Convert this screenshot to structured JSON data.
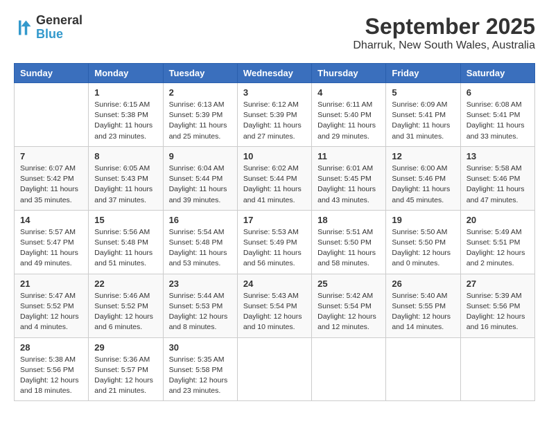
{
  "header": {
    "logo_line1": "General",
    "logo_line2": "Blue",
    "title": "September 2025",
    "subtitle": "Dharruk, New South Wales, Australia"
  },
  "calendar": {
    "days_of_week": [
      "Sunday",
      "Monday",
      "Tuesday",
      "Wednesday",
      "Thursday",
      "Friday",
      "Saturday"
    ],
    "weeks": [
      [
        {
          "day": "",
          "sunrise": "",
          "sunset": "",
          "daylight": ""
        },
        {
          "day": "1",
          "sunrise": "Sunrise: 6:15 AM",
          "sunset": "Sunset: 5:38 PM",
          "daylight": "Daylight: 11 hours and 23 minutes."
        },
        {
          "day": "2",
          "sunrise": "Sunrise: 6:13 AM",
          "sunset": "Sunset: 5:39 PM",
          "daylight": "Daylight: 11 hours and 25 minutes."
        },
        {
          "day": "3",
          "sunrise": "Sunrise: 6:12 AM",
          "sunset": "Sunset: 5:39 PM",
          "daylight": "Daylight: 11 hours and 27 minutes."
        },
        {
          "day": "4",
          "sunrise": "Sunrise: 6:11 AM",
          "sunset": "Sunset: 5:40 PM",
          "daylight": "Daylight: 11 hours and 29 minutes."
        },
        {
          "day": "5",
          "sunrise": "Sunrise: 6:09 AM",
          "sunset": "Sunset: 5:41 PM",
          "daylight": "Daylight: 11 hours and 31 minutes."
        },
        {
          "day": "6",
          "sunrise": "Sunrise: 6:08 AM",
          "sunset": "Sunset: 5:41 PM",
          "daylight": "Daylight: 11 hours and 33 minutes."
        }
      ],
      [
        {
          "day": "7",
          "sunrise": "Sunrise: 6:07 AM",
          "sunset": "Sunset: 5:42 PM",
          "daylight": "Daylight: 11 hours and 35 minutes."
        },
        {
          "day": "8",
          "sunrise": "Sunrise: 6:05 AM",
          "sunset": "Sunset: 5:43 PM",
          "daylight": "Daylight: 11 hours and 37 minutes."
        },
        {
          "day": "9",
          "sunrise": "Sunrise: 6:04 AM",
          "sunset": "Sunset: 5:44 PM",
          "daylight": "Daylight: 11 hours and 39 minutes."
        },
        {
          "day": "10",
          "sunrise": "Sunrise: 6:02 AM",
          "sunset": "Sunset: 5:44 PM",
          "daylight": "Daylight: 11 hours and 41 minutes."
        },
        {
          "day": "11",
          "sunrise": "Sunrise: 6:01 AM",
          "sunset": "Sunset: 5:45 PM",
          "daylight": "Daylight: 11 hours and 43 minutes."
        },
        {
          "day": "12",
          "sunrise": "Sunrise: 6:00 AM",
          "sunset": "Sunset: 5:46 PM",
          "daylight": "Daylight: 11 hours and 45 minutes."
        },
        {
          "day": "13",
          "sunrise": "Sunrise: 5:58 AM",
          "sunset": "Sunset: 5:46 PM",
          "daylight": "Daylight: 11 hours and 47 minutes."
        }
      ],
      [
        {
          "day": "14",
          "sunrise": "Sunrise: 5:57 AM",
          "sunset": "Sunset: 5:47 PM",
          "daylight": "Daylight: 11 hours and 49 minutes."
        },
        {
          "day": "15",
          "sunrise": "Sunrise: 5:56 AM",
          "sunset": "Sunset: 5:48 PM",
          "daylight": "Daylight: 11 hours and 51 minutes."
        },
        {
          "day": "16",
          "sunrise": "Sunrise: 5:54 AM",
          "sunset": "Sunset: 5:48 PM",
          "daylight": "Daylight: 11 hours and 53 minutes."
        },
        {
          "day": "17",
          "sunrise": "Sunrise: 5:53 AM",
          "sunset": "Sunset: 5:49 PM",
          "daylight": "Daylight: 11 hours and 56 minutes."
        },
        {
          "day": "18",
          "sunrise": "Sunrise: 5:51 AM",
          "sunset": "Sunset: 5:50 PM",
          "daylight": "Daylight: 11 hours and 58 minutes."
        },
        {
          "day": "19",
          "sunrise": "Sunrise: 5:50 AM",
          "sunset": "Sunset: 5:50 PM",
          "daylight": "Daylight: 12 hours and 0 minutes."
        },
        {
          "day": "20",
          "sunrise": "Sunrise: 5:49 AM",
          "sunset": "Sunset: 5:51 PM",
          "daylight": "Daylight: 12 hours and 2 minutes."
        }
      ],
      [
        {
          "day": "21",
          "sunrise": "Sunrise: 5:47 AM",
          "sunset": "Sunset: 5:52 PM",
          "daylight": "Daylight: 12 hours and 4 minutes."
        },
        {
          "day": "22",
          "sunrise": "Sunrise: 5:46 AM",
          "sunset": "Sunset: 5:52 PM",
          "daylight": "Daylight: 12 hours and 6 minutes."
        },
        {
          "day": "23",
          "sunrise": "Sunrise: 5:44 AM",
          "sunset": "Sunset: 5:53 PM",
          "daylight": "Daylight: 12 hours and 8 minutes."
        },
        {
          "day": "24",
          "sunrise": "Sunrise: 5:43 AM",
          "sunset": "Sunset: 5:54 PM",
          "daylight": "Daylight: 12 hours and 10 minutes."
        },
        {
          "day": "25",
          "sunrise": "Sunrise: 5:42 AM",
          "sunset": "Sunset: 5:54 PM",
          "daylight": "Daylight: 12 hours and 12 minutes."
        },
        {
          "day": "26",
          "sunrise": "Sunrise: 5:40 AM",
          "sunset": "Sunset: 5:55 PM",
          "daylight": "Daylight: 12 hours and 14 minutes."
        },
        {
          "day": "27",
          "sunrise": "Sunrise: 5:39 AM",
          "sunset": "Sunset: 5:56 PM",
          "daylight": "Daylight: 12 hours and 16 minutes."
        }
      ],
      [
        {
          "day": "28",
          "sunrise": "Sunrise: 5:38 AM",
          "sunset": "Sunset: 5:56 PM",
          "daylight": "Daylight: 12 hours and 18 minutes."
        },
        {
          "day": "29",
          "sunrise": "Sunrise: 5:36 AM",
          "sunset": "Sunset: 5:57 PM",
          "daylight": "Daylight: 12 hours and 21 minutes."
        },
        {
          "day": "30",
          "sunrise": "Sunrise: 5:35 AM",
          "sunset": "Sunset: 5:58 PM",
          "daylight": "Daylight: 12 hours and 23 minutes."
        },
        {
          "day": "",
          "sunrise": "",
          "sunset": "",
          "daylight": ""
        },
        {
          "day": "",
          "sunrise": "",
          "sunset": "",
          "daylight": ""
        },
        {
          "day": "",
          "sunrise": "",
          "sunset": "",
          "daylight": ""
        },
        {
          "day": "",
          "sunrise": "",
          "sunset": "",
          "daylight": ""
        }
      ]
    ]
  }
}
